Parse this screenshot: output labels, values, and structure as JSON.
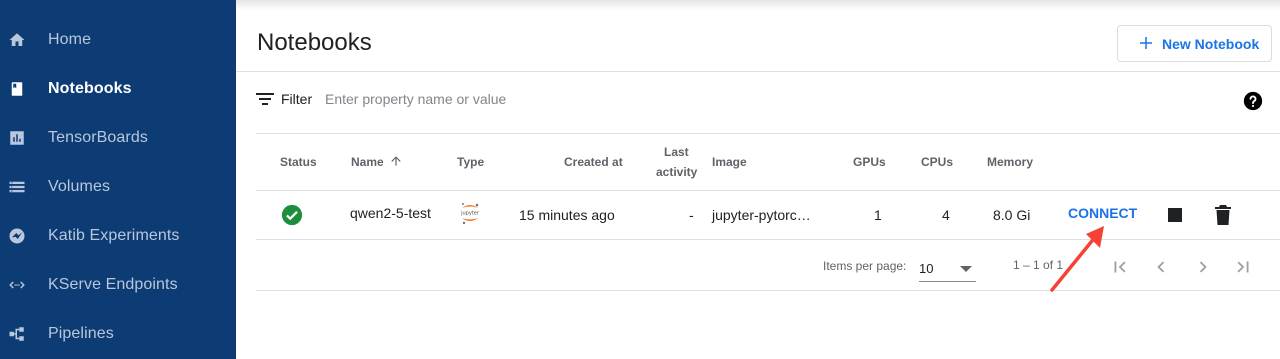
{
  "sidebar": {
    "items": [
      {
        "label": "Home",
        "icon": "home-icon"
      },
      {
        "label": "Notebooks",
        "icon": "notebook-icon",
        "active": true
      },
      {
        "label": "TensorBoards",
        "icon": "chart-icon"
      },
      {
        "label": "Volumes",
        "icon": "storage-icon"
      },
      {
        "label": "Katib Experiments",
        "icon": "katib-icon"
      },
      {
        "label": "KServe Endpoints",
        "icon": "code-arrows-icon"
      },
      {
        "label": "Pipelines",
        "icon": "pipeline-icon"
      }
    ]
  },
  "page": {
    "title": "Notebooks",
    "new_button": "New Notebook"
  },
  "filter": {
    "label": "Filter",
    "placeholder": "Enter property name or value"
  },
  "table": {
    "headers": {
      "status": "Status",
      "name": "Name",
      "type": "Type",
      "created": "Created at",
      "last_activity_1": "Last",
      "last_activity_2": "activity",
      "image": "Image",
      "gpus": "GPUs",
      "cpus": "CPUs",
      "memory": "Memory"
    },
    "rows": [
      {
        "status": "running",
        "name": "qwen2-5-test",
        "type": "jupyter",
        "created": "15 minutes ago",
        "last_activity": "-",
        "image": "jupyter-pytorc…",
        "gpus": "1",
        "cpus": "4",
        "memory": "8.0 Gi",
        "action": "CONNECT"
      }
    ]
  },
  "pagination": {
    "items_per_page_label": "Items per page:",
    "items_per_page": "10",
    "range": "1 – 1 of 1"
  },
  "colors": {
    "sidebar_bg": "#0d3c74",
    "accent": "#1a73e8",
    "status_ok": "#1e8e3e",
    "annotation_arrow": "#f44336"
  }
}
